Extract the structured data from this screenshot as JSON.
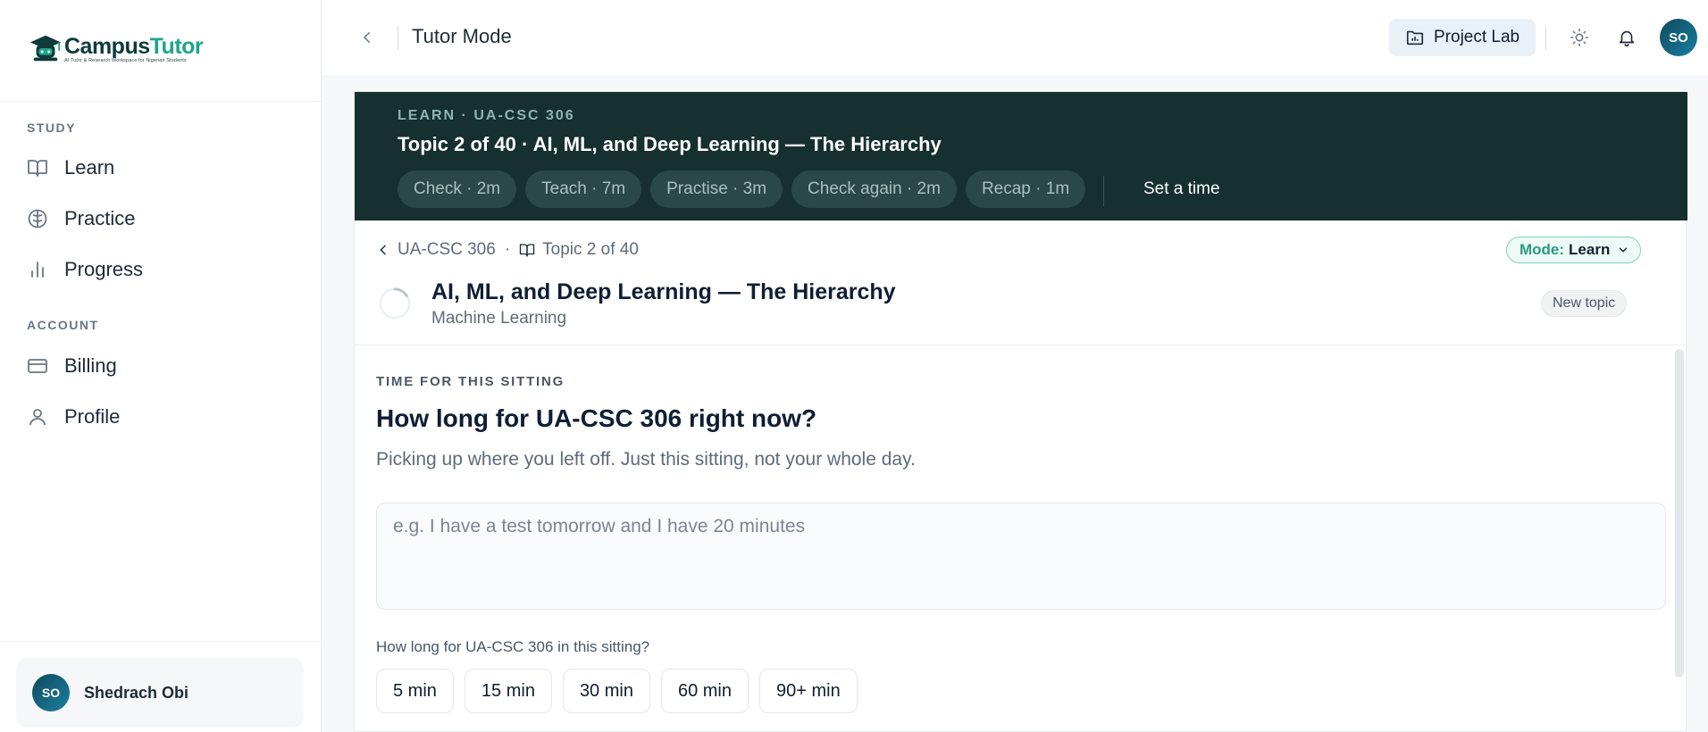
{
  "app": {
    "logo": {
      "name_part1": "Campus",
      "name_part2": "Tutor",
      "tagline": "AI Tutor & Research Workspace for Nigerian Students"
    }
  },
  "sidebar": {
    "study_label": "STUDY",
    "study_items": [
      {
        "label": "Learn",
        "icon": "book-open-icon"
      },
      {
        "label": "Practice",
        "icon": "brain-icon"
      },
      {
        "label": "Progress",
        "icon": "bar-chart-icon"
      }
    ],
    "account_label": "ACCOUNT",
    "account_items": [
      {
        "label": "Billing",
        "icon": "credit-card-icon"
      },
      {
        "label": "Profile",
        "icon": "user-icon"
      }
    ],
    "user": {
      "initials": "SO",
      "name": "Shedrach Obi"
    }
  },
  "topbar": {
    "title": "Tutor Mode",
    "project_lab": "Project Lab",
    "avatar_initials": "SO"
  },
  "banner": {
    "kicker": "LEARN · UA-CSC 306",
    "title": "Topic 2 of 40 · AI, ML, and Deep Learning — The Hierarchy",
    "steps": [
      "Check · 2m",
      "Teach · 7m",
      "Practise · 3m",
      "Check again · 2m",
      "Recap · 1m"
    ],
    "set_time": "Set a time"
  },
  "breadcrumb": {
    "course": "UA-CSC 306",
    "separator": "·",
    "topic": "Topic 2 of 40"
  },
  "mode": {
    "key": "Mode:",
    "value": "Learn"
  },
  "topic": {
    "title": "AI, ML, and Deep Learning — The Hierarchy",
    "subtitle": "Machine Learning",
    "badge": "New topic"
  },
  "sitting": {
    "kicker": "TIME FOR THIS SITTING",
    "title": "How long for UA-CSC 306 right now?",
    "description": "Picking up where you left off. Just this sitting, not your whole day.",
    "placeholder": "e.g. I have a test tomorrow and I have 20 minutes",
    "duration_label": "How long for UA-CSC 306 in this sitting?",
    "durations": [
      "5 min",
      "15 min",
      "30 min",
      "60 min",
      "90+ min"
    ]
  },
  "colors": {
    "banner_bg": "#15302f",
    "accent": "#1fa58a",
    "avatar": "#0e4a5c"
  }
}
